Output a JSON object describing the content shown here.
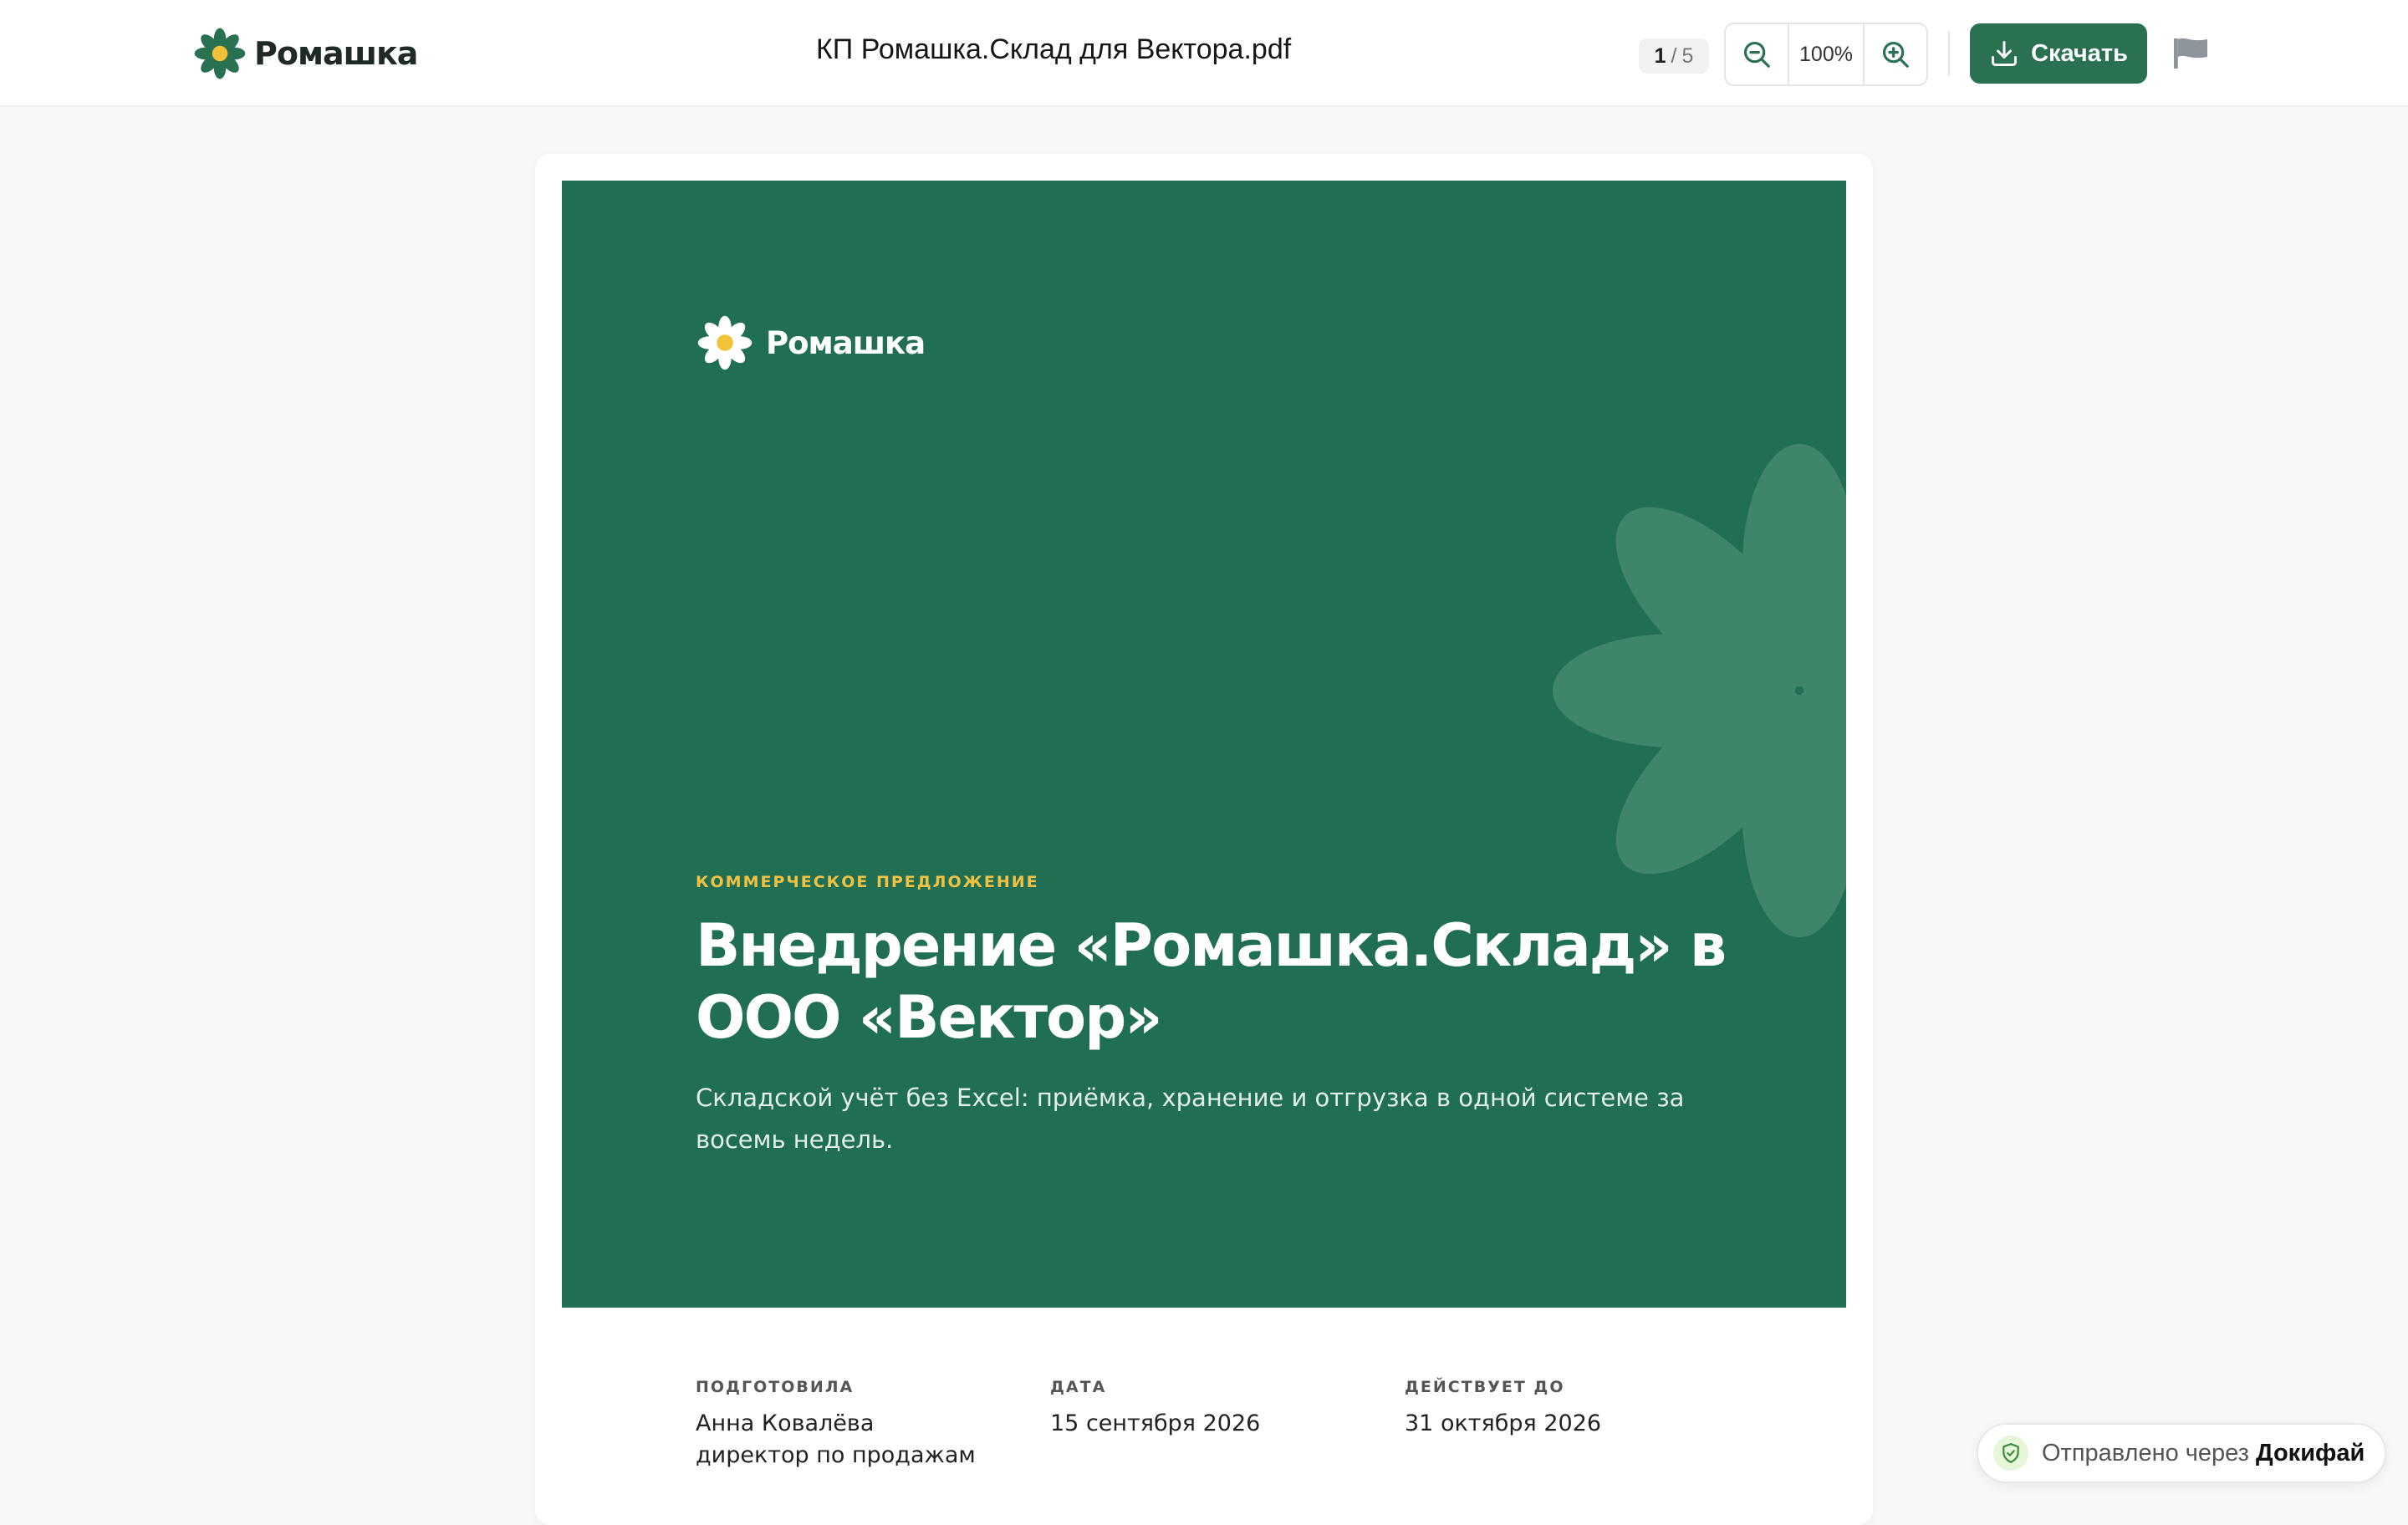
{
  "header": {
    "brand_name": "Ромашка",
    "document_title": "КП Ромашка.Склад для Вектора.pdf",
    "page_current": "1",
    "page_separator": "/",
    "page_total": "5",
    "zoom_level": "100%",
    "download_label": "Скачать"
  },
  "cover": {
    "brand_name": "Ромашка",
    "eyebrow": "КОММЕРЧЕСКОЕ ПРЕДЛОЖЕНИЕ",
    "headline": "Внедрение «Ромашка.Склад» в ООО «Вектор»",
    "subtitle": "Складской учёт без Excel: приёмка, хранение и отгрузка в одной системе за восемь недель."
  },
  "meta": {
    "prepared_label": "ПОДГОТОВИЛА",
    "prepared_name": "Анна Ковалёва",
    "prepared_role": "директор по продажам",
    "date_label": "ДАТА",
    "date_value": "15 сентября 2026",
    "valid_label": "ДЕЙСТВУЕТ ДО",
    "valid_value": "31 октября 2026"
  },
  "badge": {
    "text": "Отправлено через",
    "service": "Докифай"
  },
  "icons": {
    "brand": "daisy-logo-icon",
    "zoom_out": "zoom-out-icon",
    "zoom_in": "zoom-in-icon",
    "download": "download-icon",
    "flag": "flag-icon",
    "shield": "shield-check-icon"
  },
  "colors": {
    "brand_green": "#2a7152",
    "cover_green": "#216f53",
    "accent_yellow": "#f0c244",
    "flag_gray": "#8d949c"
  }
}
